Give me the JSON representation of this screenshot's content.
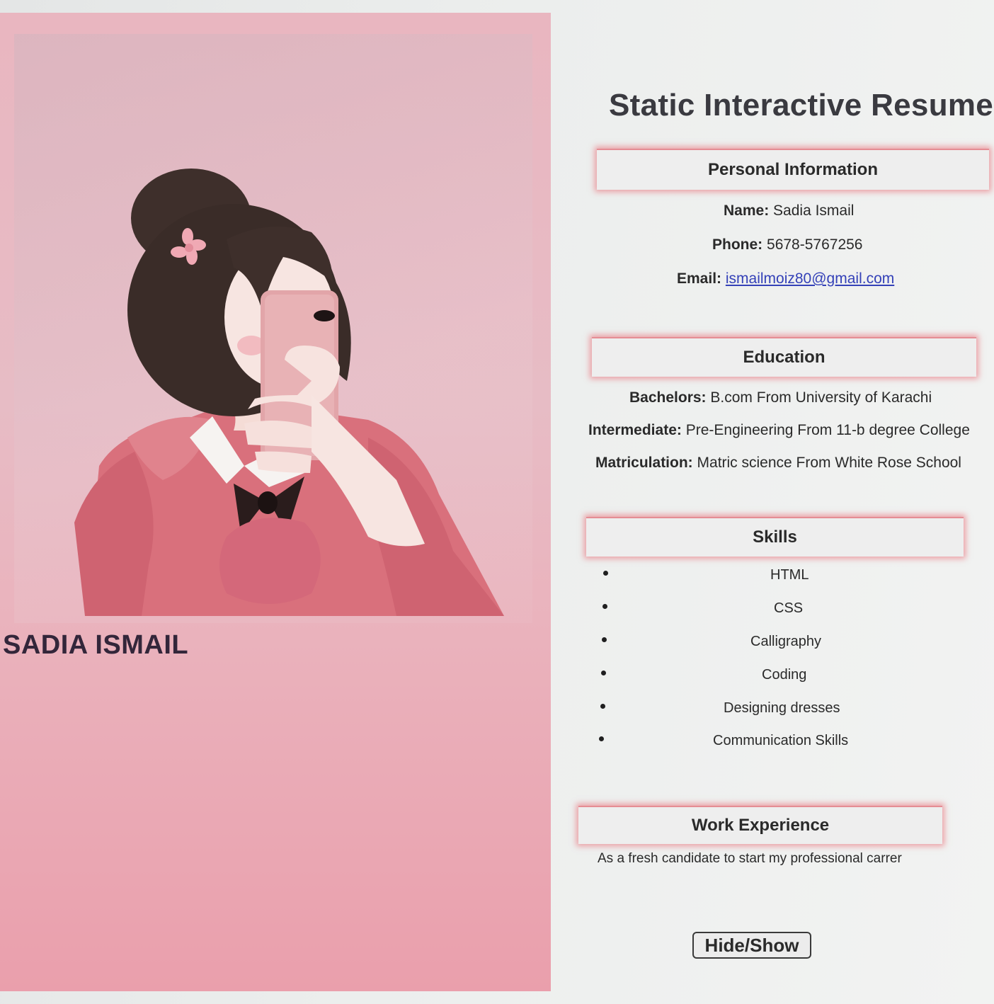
{
  "profile": {
    "name": "SADIA ISMAIL"
  },
  "page": {
    "title": "Static Interactive Resume"
  },
  "personal_info": {
    "heading": "Personal Information",
    "name_label": "Name:",
    "name_value": "Sadia Ismail",
    "phone_label": "Phone:",
    "phone_value": "5678-5767256",
    "email_label": "Email:",
    "email_value": "ismailmoiz80@gmail.com"
  },
  "education": {
    "heading": "Education",
    "items": [
      {
        "label": "Bachelors:",
        "value": "B.com From University of Karachi"
      },
      {
        "label": "Intermediate:",
        "value": "Pre-Engineering From 11-b degree College"
      },
      {
        "label": "Matriculation:",
        "value": "Matric science From White Rose School"
      }
    ]
  },
  "skills": {
    "heading": "Skills",
    "items": [
      "HTML",
      "CSS",
      "Calligraphy",
      "Coding",
      "Designing dresses",
      "Communication Skills"
    ]
  },
  "work_experience": {
    "heading": "Work Experience",
    "text": "As a fresh candidate to start my professional carrer"
  },
  "controls": {
    "toggle_label": "Hide/Show"
  },
  "colors": {
    "panel_pink": "#e9b6c0",
    "header_glow": "#e85a64",
    "link_blue": "#3441b8"
  }
}
